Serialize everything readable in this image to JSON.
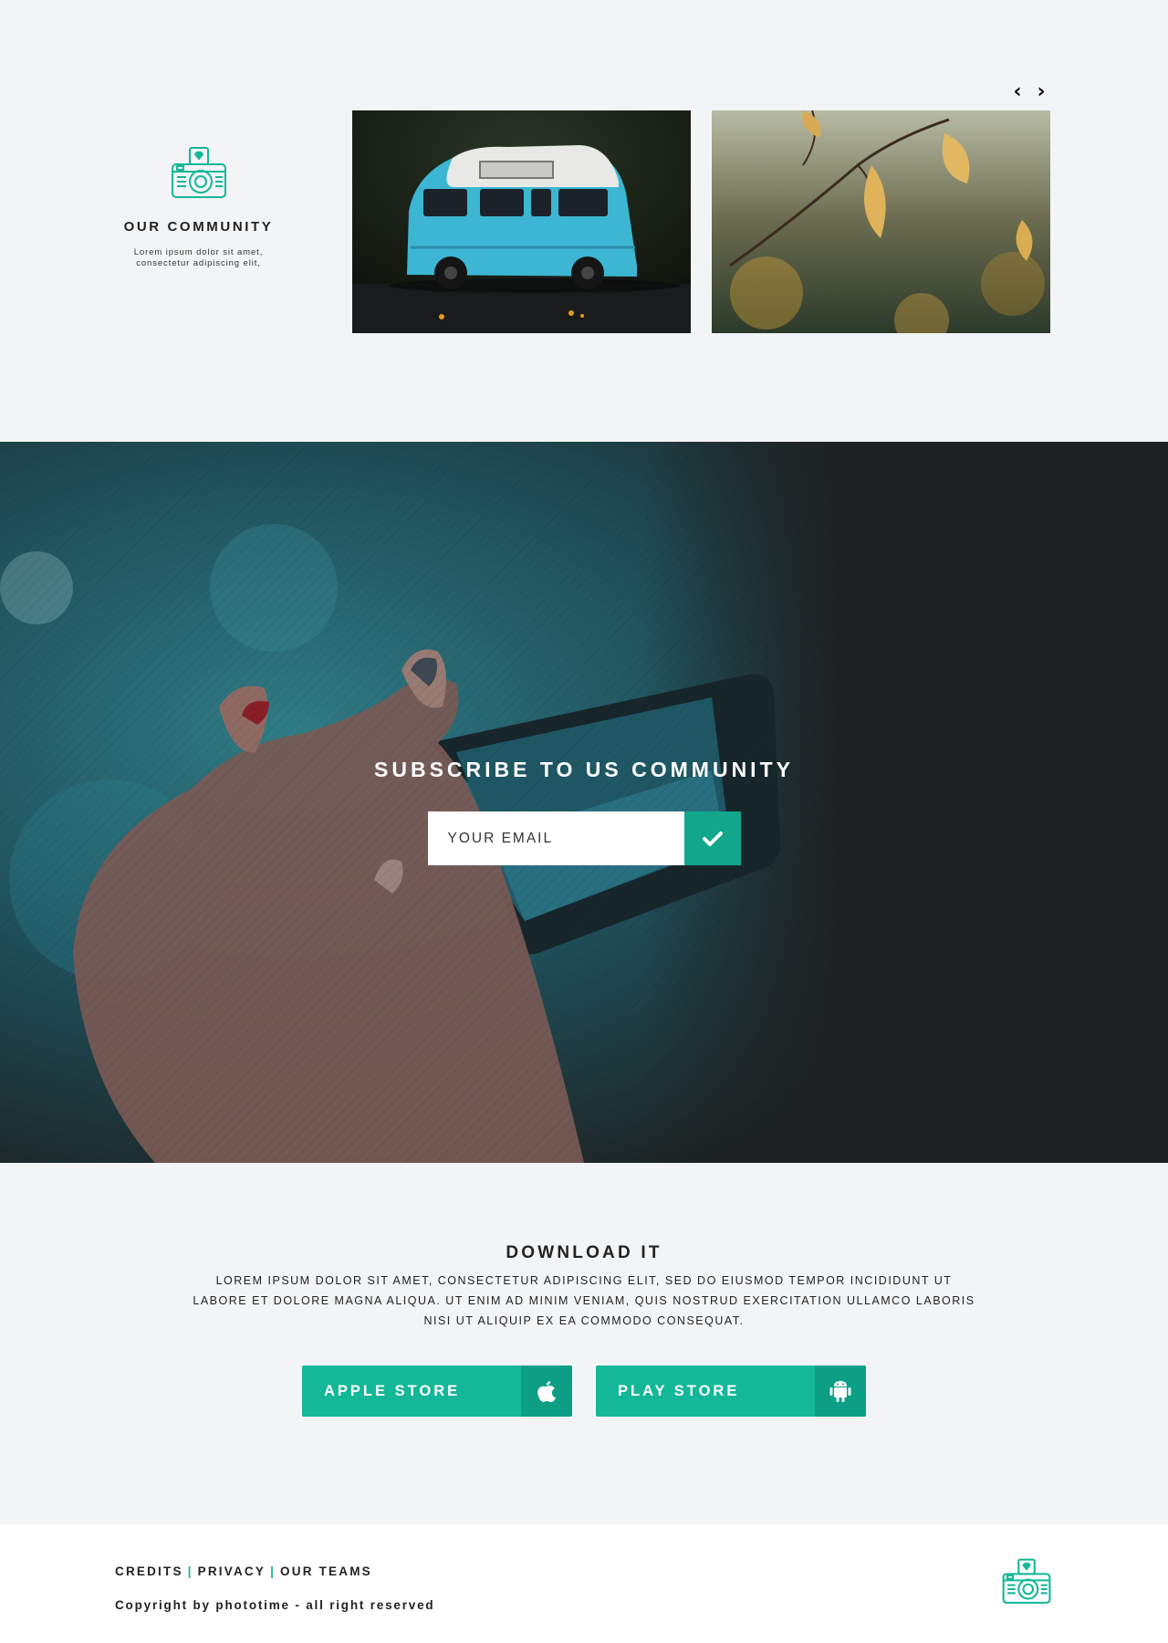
{
  "community": {
    "title": "OUR COMMUNITY",
    "text": "Lorem ipsum dolor sit amet, consectetur adipiscing elit,",
    "icon": "camera-heart-icon",
    "nav_prev": "‹",
    "nav_next": "›",
    "photos": [
      "camper-van-photo",
      "autumn-leaves-photo"
    ]
  },
  "subscribe": {
    "title": "SUBSCRIBE TO US COMMUNITY",
    "email_placeholder": "YOUR EMAIL",
    "submit_icon": "check-icon",
    "background": "hand-holding-phone-photo"
  },
  "download": {
    "title": "DOWNLOAD IT",
    "text": "Lorem ipsum dolor sit amet, consectetur adipiscing elit, sed do eiusmod tempor incididunt ut labore et dolore magna aliqua. Ut enim ad minim veniam, quis nostrud exercitation ullamco laboris nisi ut aliquip ex ea commodo consequat.",
    "apple_label": "APPLE STORE",
    "apple_icon": "apple-icon",
    "play_label": "PLAY STORE",
    "play_icon": "android-icon"
  },
  "footer": {
    "links": [
      "CREDITS",
      "PRIVACY",
      "OUR TEAMS"
    ],
    "separator": "|",
    "copyright": "Copyright by phototime - all right reserved",
    "logo_icon": "camera-heart-icon"
  },
  "colors": {
    "accent": "#14b797",
    "accent_dark": "#0d9f83",
    "page_bg": "#f3f4f6",
    "text": "#222222"
  }
}
